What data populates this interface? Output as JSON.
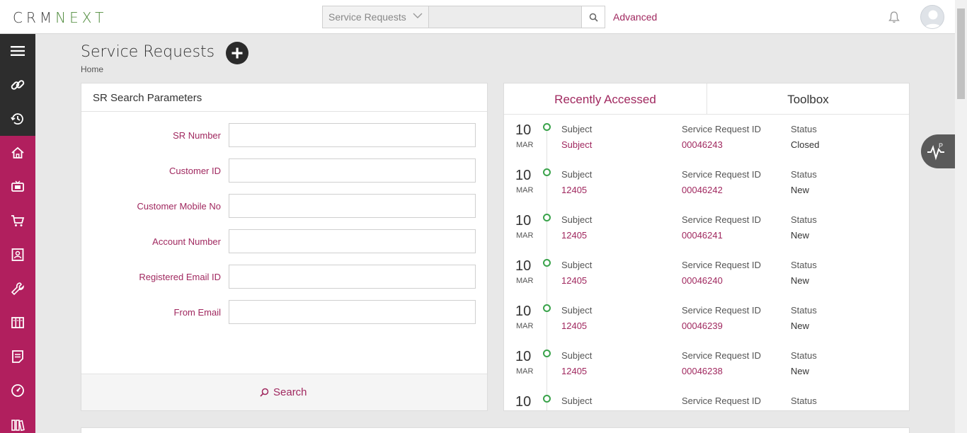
{
  "app": {
    "logo_prefix": "CRM",
    "logo_suffix": "NEXT"
  },
  "search": {
    "module": "Service Requests",
    "query": "",
    "advanced_label": "Advanced"
  },
  "page": {
    "title": "Service Requests",
    "breadcrumb": "Home"
  },
  "sidebar": {
    "items": [
      {
        "icon": "hamburger-menu-icon"
      },
      {
        "icon": "link-icon"
      },
      {
        "icon": "history-icon"
      },
      {
        "icon": "home-icon"
      },
      {
        "icon": "tv-icon"
      },
      {
        "icon": "cart-icon"
      },
      {
        "icon": "contact-card-icon"
      },
      {
        "icon": "wrench-icon"
      },
      {
        "icon": "columns-icon"
      },
      {
        "icon": "notes-icon"
      },
      {
        "icon": "dashboard-icon"
      },
      {
        "icon": "library-icon"
      }
    ]
  },
  "sr_search": {
    "title": "SR Search Parameters",
    "fields": [
      {
        "label": "SR Number",
        "value": ""
      },
      {
        "label": "Customer ID",
        "value": ""
      },
      {
        "label": "Customer Mobile No",
        "value": ""
      },
      {
        "label": "Account Number",
        "value": ""
      },
      {
        "label": "Registered Email ID",
        "value": ""
      },
      {
        "label": "From Email",
        "value": ""
      }
    ],
    "search_label": "Search"
  },
  "recent": {
    "tabs": [
      "Recently Accessed",
      "Toolbox"
    ],
    "active_tab": "Recently Accessed",
    "col_labels": {
      "subject": "Subject",
      "id": "Service Request ID",
      "status": "Status"
    },
    "entries": [
      {
        "day": "10",
        "month": "MAR",
        "subject": "Subject",
        "id": "00046243",
        "status": "Closed"
      },
      {
        "day": "10",
        "month": "MAR",
        "subject": "12405",
        "id": "00046242",
        "status": "New"
      },
      {
        "day": "10",
        "month": "MAR",
        "subject": "12405",
        "id": "00046241",
        "status": "New"
      },
      {
        "day": "10",
        "month": "MAR",
        "subject": "12405",
        "id": "00046240",
        "status": "New"
      },
      {
        "day": "10",
        "month": "MAR",
        "subject": "12405",
        "id": "00046239",
        "status": "New"
      },
      {
        "day": "10",
        "month": "MAR",
        "subject": "12405",
        "id": "00046238",
        "status": "New"
      },
      {
        "day": "10",
        "month": "",
        "subject": "",
        "id": "",
        "status": ""
      }
    ]
  },
  "colors": {
    "brand": "#b11f5e",
    "accent_text": "#a0285f",
    "sidebar_dark": "#2d2d2d",
    "timeline_dot": "#3aa34b"
  }
}
